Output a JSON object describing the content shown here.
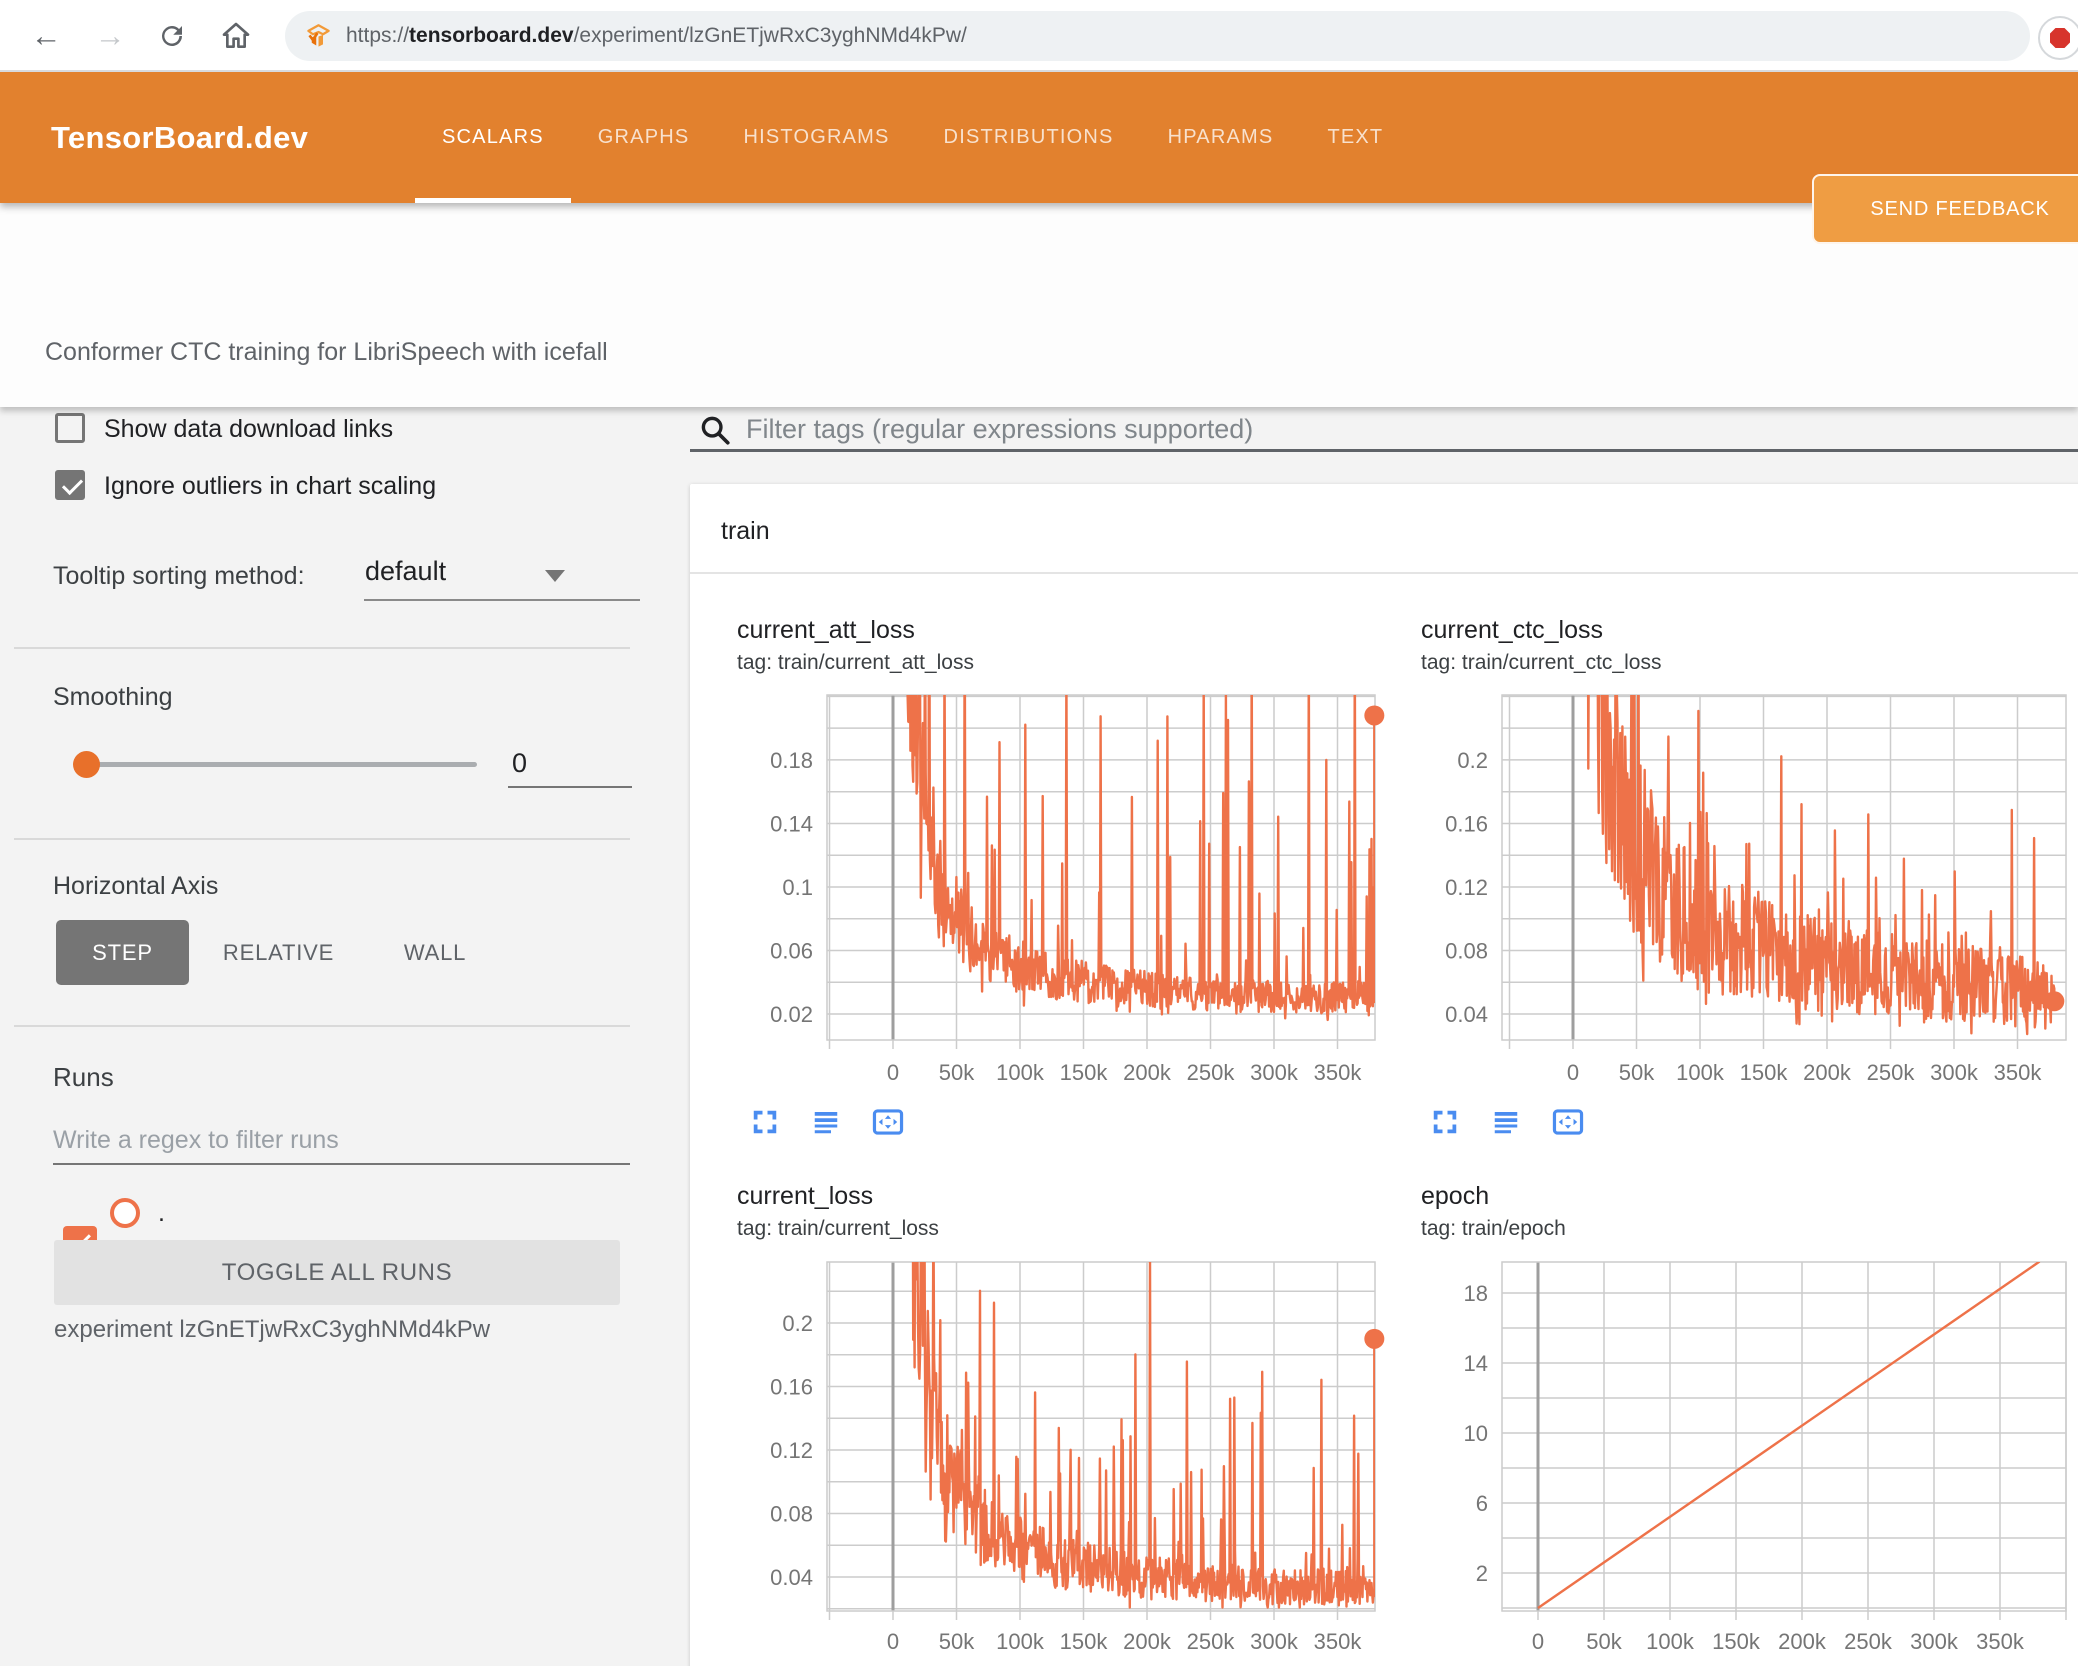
{
  "browser": {
    "url_scheme": "https://",
    "url_domain": "tensorboard.dev",
    "url_path": "/experiment/lzGnETjwRxC3yghNMd4kPw/"
  },
  "header": {
    "brand": "TensorBoard.dev",
    "tabs": [
      {
        "label": "SCALARS",
        "active": true
      },
      {
        "label": "GRAPHS",
        "active": false
      },
      {
        "label": "HISTOGRAMS",
        "active": false
      },
      {
        "label": "DISTRIBUTIONS",
        "active": false
      },
      {
        "label": "HPARAMS",
        "active": false
      },
      {
        "label": "TEXT",
        "active": false
      }
    ],
    "feedback_label": "SEND FEEDBACK",
    "colors": {
      "bar": "#e2812e",
      "button": "#ef9d43"
    }
  },
  "subtitle": "Conformer CTC training for LibriSpeech with icefall",
  "sidebar": {
    "checkboxes": [
      {
        "label": "Show data download links",
        "checked": false
      },
      {
        "label": "Ignore outliers in chart scaling",
        "checked": true
      }
    ],
    "tooltip_sorting": {
      "label": "Tooltip sorting method:",
      "value": "default"
    },
    "smoothing": {
      "label": "Smoothing",
      "value": "0"
    },
    "horizontal_axis": {
      "label": "Horizontal Axis",
      "options": [
        {
          "label": "STEP",
          "active": true
        },
        {
          "label": "RELATIVE",
          "active": false
        },
        {
          "label": "WALL",
          "active": false
        }
      ]
    },
    "runs": {
      "label": "Runs",
      "filter_placeholder": "Write a regex to filter runs",
      "run_item": {
        "name": ".",
        "checked": true,
        "color": "#ee7249"
      },
      "toggle_button": "TOGGLE ALL RUNS",
      "experiment_label": "experiment lzGnETjwRxC3yghNMd4kPw"
    }
  },
  "main": {
    "filter_placeholder": "Filter tags (regular expressions supported)",
    "section_title": "train"
  },
  "chart_data": [
    {
      "type": "line",
      "title": "current_att_loss",
      "tag": "tag: train/current_att_loss",
      "xlabel": "step",
      "x_range": [
        0,
        379000
      ],
      "y_range": [
        0.0036,
        0.2209
      ],
      "y_grid_step": 0.02,
      "y_ticks": [
        {
          "v": 0.02,
          "label": "0.02"
        },
        {
          "v": 0.06,
          "label": "0.06"
        },
        {
          "v": 0.1,
          "label": "0.1"
        },
        {
          "v": 0.14,
          "label": "0.14"
        },
        {
          "v": 0.18,
          "label": "0.18"
        }
      ],
      "x_ticks": [
        {
          "s": 0,
          "label": "0"
        },
        {
          "s": 50000,
          "label": "50k"
        },
        {
          "s": 100000,
          "label": "100k"
        },
        {
          "s": 150000,
          "label": "150k"
        },
        {
          "s": 200000,
          "label": "200k"
        },
        {
          "s": 250000,
          "label": "250k"
        },
        {
          "s": 300000,
          "label": "300k"
        },
        {
          "s": 350000,
          "label": "350k"
        }
      ],
      "line_color": "#ee7249",
      "trend": [
        [
          6000,
          0.55
        ],
        [
          12000,
          0.32
        ],
        [
          18000,
          0.22
        ],
        [
          25000,
          0.15
        ],
        [
          35000,
          0.11
        ],
        [
          50000,
          0.085
        ],
        [
          70000,
          0.065
        ],
        [
          100000,
          0.052
        ],
        [
          140000,
          0.045
        ],
        [
          180000,
          0.04
        ],
        [
          230000,
          0.036
        ],
        [
          280000,
          0.034
        ],
        [
          330000,
          0.032
        ],
        [
          379000,
          0.034
        ]
      ],
      "noise": {
        "band": [
          0.62,
          0.6
        ],
        "spike_p": 0.88,
        "spike_amp": [
          0.1,
          0.16
        ],
        "seed": 42,
        "n": 680
      },
      "end_point": {
        "step": 379000,
        "value": 0.208
      }
    },
    {
      "type": "line",
      "title": "current_ctc_loss",
      "tag": "tag: train/current_ctc_loss",
      "xlabel": "step",
      "x_range": [
        0,
        379000
      ],
      "y_range": [
        0.0236,
        0.2409
      ],
      "y_grid_step": 0.02,
      "y_ticks": [
        {
          "v": 0.04,
          "label": "0.04"
        },
        {
          "v": 0.08,
          "label": "0.08"
        },
        {
          "v": 0.12,
          "label": "0.12"
        },
        {
          "v": 0.16,
          "label": "0.16"
        },
        {
          "v": 0.2,
          "label": "0.2"
        }
      ],
      "x_ticks": [
        {
          "s": 0,
          "label": "0"
        },
        {
          "s": 50000,
          "label": "50k"
        },
        {
          "s": 100000,
          "label": "100k"
        },
        {
          "s": 150000,
          "label": "150k"
        },
        {
          "s": 200000,
          "label": "200k"
        },
        {
          "s": 250000,
          "label": "250k"
        },
        {
          "s": 300000,
          "label": "300k"
        },
        {
          "s": 350000,
          "label": "350k"
        }
      ],
      "line_color": "#ee7249",
      "trend": [
        [
          6000,
          0.6
        ],
        [
          12000,
          0.4
        ],
        [
          18000,
          0.3
        ],
        [
          25000,
          0.24
        ],
        [
          35000,
          0.19
        ],
        [
          50000,
          0.15
        ],
        [
          70000,
          0.12
        ],
        [
          100000,
          0.098
        ],
        [
          140000,
          0.085
        ],
        [
          180000,
          0.075
        ],
        [
          230000,
          0.068
        ],
        [
          280000,
          0.062
        ],
        [
          330000,
          0.058
        ],
        [
          379000,
          0.05
        ]
      ],
      "noise": {
        "band": [
          0.55,
          0.85
        ],
        "spike_p": 0.9,
        "spike_amp": [
          0.05,
          0.09
        ],
        "seed": 137,
        "n": 680
      },
      "end_point": {
        "step": 379000,
        "value": 0.048
      }
    },
    {
      "type": "line",
      "title": "current_loss",
      "tag": "tag: train/current_loss",
      "xlabel": "step",
      "x_range": [
        0,
        379000
      ],
      "y_range": [
        0.0186,
        0.2384
      ],
      "y_grid_step": 0.02,
      "y_ticks": [
        {
          "v": 0.04,
          "label": "0.04"
        },
        {
          "v": 0.08,
          "label": "0.08"
        },
        {
          "v": 0.12,
          "label": "0.12"
        },
        {
          "v": 0.16,
          "label": "0.16"
        },
        {
          "v": 0.2,
          "label": "0.2"
        }
      ],
      "x_ticks": [
        {
          "s": 0,
          "label": "0"
        },
        {
          "s": 50000,
          "label": "50k"
        },
        {
          "s": 100000,
          "label": "100k"
        },
        {
          "s": 150000,
          "label": "150k"
        },
        {
          "s": 200000,
          "label": "200k"
        },
        {
          "s": 250000,
          "label": "250k"
        },
        {
          "s": 300000,
          "label": "300k"
        },
        {
          "s": 350000,
          "label": "350k"
        }
      ],
      "line_color": "#ee7249",
      "trend": [
        [
          6000,
          0.6
        ],
        [
          12000,
          0.38
        ],
        [
          18000,
          0.26
        ],
        [
          25000,
          0.18
        ],
        [
          35000,
          0.13
        ],
        [
          50000,
          0.1
        ],
        [
          70000,
          0.078
        ],
        [
          100000,
          0.062
        ],
        [
          140000,
          0.052
        ],
        [
          180000,
          0.046
        ],
        [
          230000,
          0.04
        ],
        [
          280000,
          0.038
        ],
        [
          330000,
          0.036
        ],
        [
          379000,
          0.038
        ]
      ],
      "noise": {
        "band": [
          0.6,
          0.65
        ],
        "spike_p": 0.88,
        "spike_amp": [
          0.09,
          0.16
        ],
        "seed": 7,
        "n": 680
      },
      "end_point": {
        "step": 379000,
        "value": 0.19
      }
    },
    {
      "type": "line",
      "title": "epoch",
      "tag": "tag: train/epoch",
      "xlabel": "step",
      "x_range": [
        0,
        380000
      ],
      "y_range": [
        -0.171,
        19.77
      ],
      "y_grid_step": 2,
      "y_ticks": [
        {
          "v": 2,
          "label": "2"
        },
        {
          "v": 6,
          "label": "6"
        },
        {
          "v": 10,
          "label": "10"
        },
        {
          "v": 14,
          "label": "14"
        },
        {
          "v": 18,
          "label": "18"
        }
      ],
      "x_ticks": [
        {
          "s": 0,
          "label": "0"
        },
        {
          "s": 50000,
          "label": "50k"
        },
        {
          "s": 100000,
          "label": "100k"
        },
        {
          "s": 150000,
          "label": "150k"
        },
        {
          "s": 200000,
          "label": "200k"
        },
        {
          "s": 250000,
          "label": "250k"
        },
        {
          "s": 300000,
          "label": "300k"
        },
        {
          "s": 350000,
          "label": "350k"
        }
      ],
      "line_color": "#ee7249",
      "trend": [
        [
          0,
          0
        ],
        [
          380000,
          19.8
        ]
      ],
      "noise": null,
      "end_point": null
    }
  ]
}
